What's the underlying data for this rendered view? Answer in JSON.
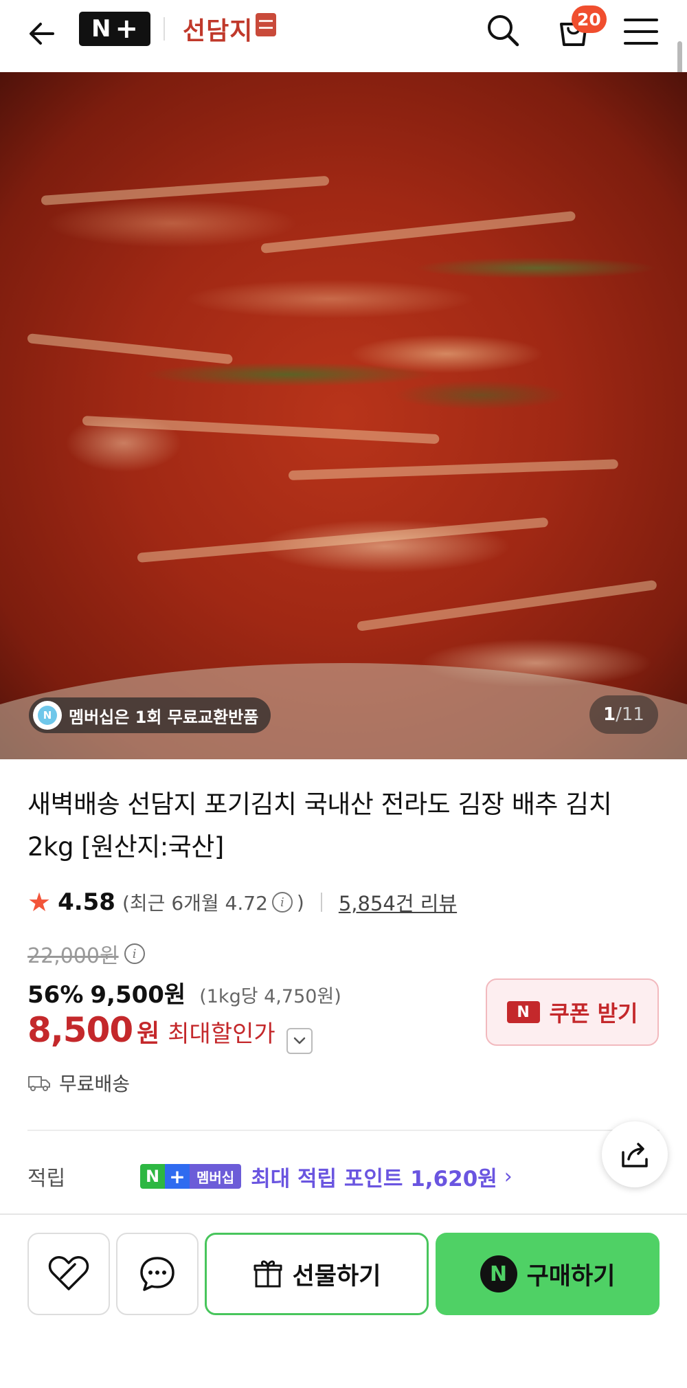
{
  "header": {
    "logo_text": "N",
    "brand_name": "선담지",
    "cart_count": "20"
  },
  "hero": {
    "membership_chip": "멤버십은 1회 무료교환반품",
    "chip_icon_letter": "N",
    "page_current": "1",
    "page_total": "/11"
  },
  "product": {
    "title": "새벽배송 선담지 포기김치 국내산 전라도 김장 배추 김치 2kg [원산지:국산]",
    "rating": "4.58",
    "recent_rating": "(최근 6개월 4.72",
    "recent_rating_close": ")",
    "review_count": "5,854건 리뷰",
    "original_price": "22,000원",
    "discount_pct": "56%",
    "sale_price": "9,500원",
    "unit_price": "(1kg당 4,750원)",
    "best_price": "8,500",
    "best_price_won": "원",
    "best_price_label": "최대할인가",
    "coupon_label": "쿠폰 받기",
    "shipping": "무료배송"
  },
  "points": {
    "label": "적립",
    "chip_n": "N",
    "chip_plus": "+",
    "chip_membership": "멤버십",
    "text": "최대 적립 포인트 1,620원",
    "chevron": "›"
  },
  "bottom_bar": {
    "gift_label": "선물하기",
    "buy_label": "구매하기",
    "buy_icon_letter": "N"
  },
  "colors": {
    "accent_green": "#4fd165",
    "sale_red": "#c4282b",
    "points_purple": "#6a55e0",
    "badge_orange": "#f04e2e"
  },
  "icons": [
    "back-arrow-icon",
    "search-icon",
    "cart-icon",
    "menu-icon",
    "star-icon",
    "info-icon",
    "chevron-down-icon",
    "truck-icon",
    "share-icon",
    "heart-icon",
    "chat-icon",
    "gift-icon"
  ]
}
